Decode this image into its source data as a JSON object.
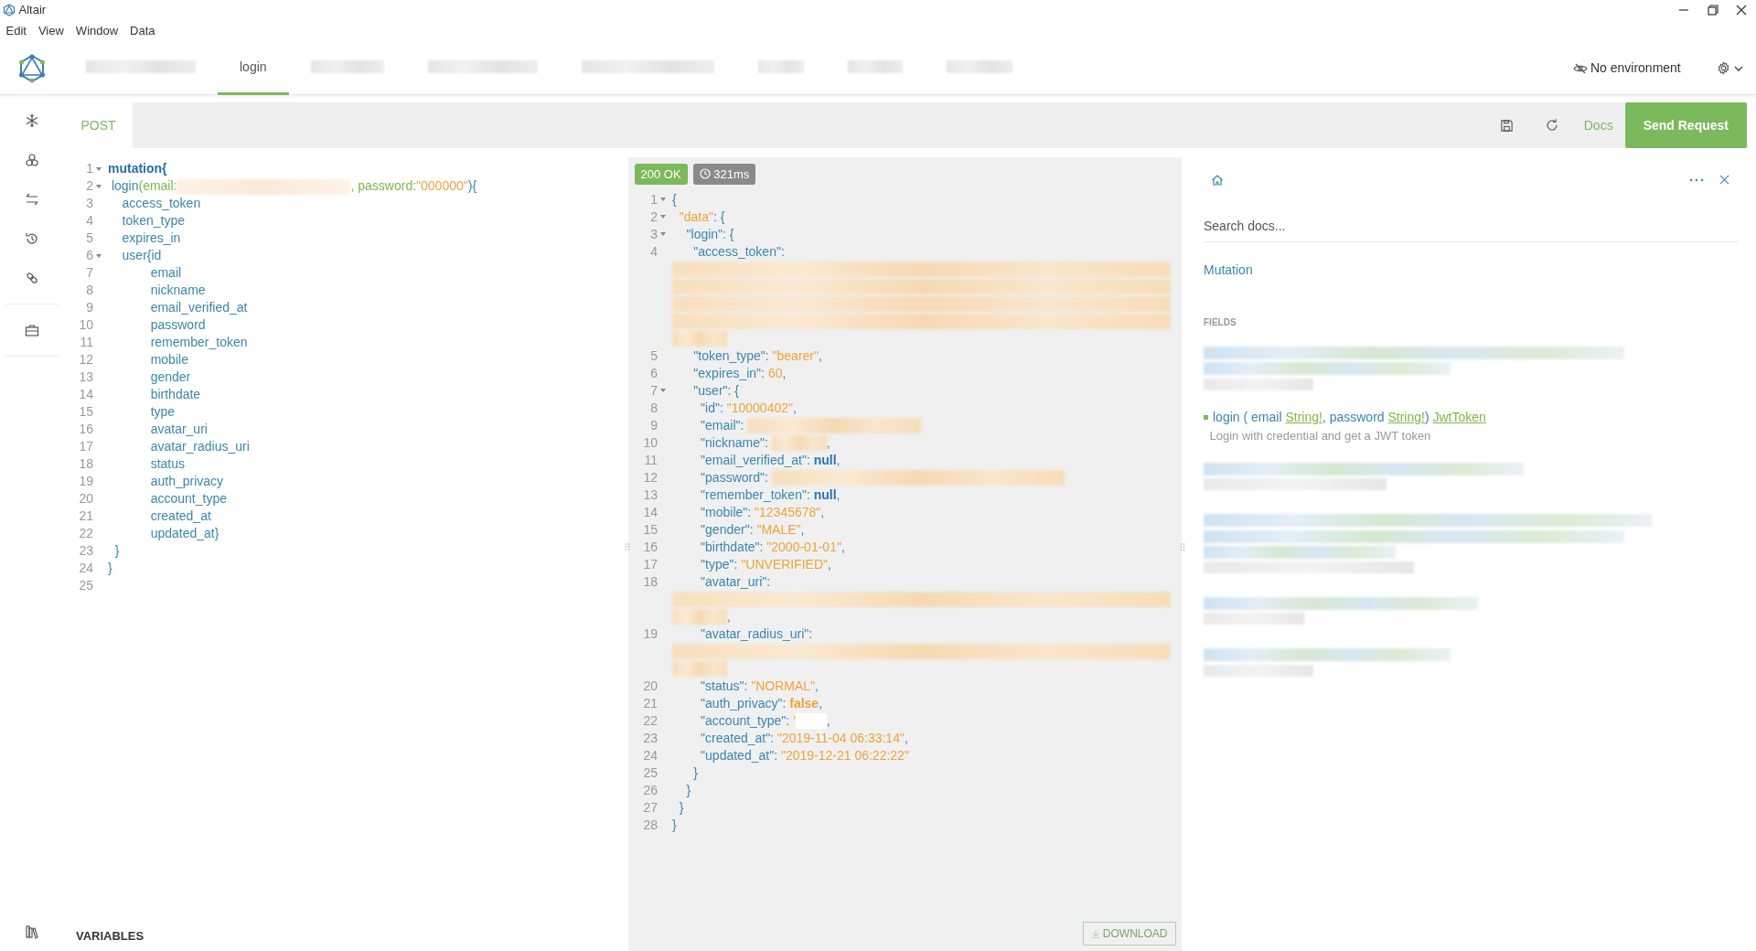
{
  "window": {
    "title": "Altair"
  },
  "menu": [
    "Edit",
    "View",
    "Window",
    "Data"
  ],
  "tabs": [
    {
      "kind": "redacted",
      "selected": false
    },
    {
      "kind": "label",
      "label": "login",
      "selected": true
    },
    {
      "kind": "redacted",
      "selected": false
    },
    {
      "kind": "redacted",
      "selected": false
    },
    {
      "kind": "redacted",
      "selected": false
    },
    {
      "kind": "redacted",
      "selected": false
    },
    {
      "kind": "redacted",
      "selected": false
    },
    {
      "kind": "redacted",
      "selected": false
    }
  ],
  "environment": "No environment",
  "request": {
    "method": "POST",
    "docs": "Docs",
    "send": "Send Request"
  },
  "query": {
    "lines": [
      {
        "number": "1",
        "fold": true,
        "tokens": [
          {
            "kind": "keyword",
            "text": "mutation{"
          }
        ]
      },
      {
        "number": "2",
        "fold": true,
        "tokens": [
          {
            "kind": "field",
            "text": " login"
          },
          {
            "kind": "arg",
            "text": "(email:"
          },
          {
            "kind": "redacted"
          },
          {
            "kind": "arg",
            "text": ", password:"
          },
          {
            "kind": "string",
            "text": "\"000000\""
          },
          {
            "kind": "field",
            "text": "){"
          }
        ]
      },
      {
        "number": "3",
        "fold": false,
        "tokens": [
          {
            "kind": "field",
            "text": "    access_token"
          }
        ]
      },
      {
        "number": "4",
        "fold": false,
        "tokens": [
          {
            "kind": "field",
            "text": "    token_type"
          }
        ]
      },
      {
        "number": "5",
        "fold": false,
        "tokens": [
          {
            "kind": "field",
            "text": "    expires_in"
          }
        ]
      },
      {
        "number": "6",
        "fold": true,
        "tokens": [
          {
            "kind": "field",
            "text": "    user{id"
          }
        ]
      },
      {
        "number": "7",
        "fold": false,
        "tokens": [
          {
            "kind": "field",
            "text": "            email"
          }
        ]
      },
      {
        "number": "8",
        "fold": false,
        "tokens": [
          {
            "kind": "field",
            "text": "            nickname"
          }
        ]
      },
      {
        "number": "9",
        "fold": false,
        "tokens": [
          {
            "kind": "field",
            "text": "            email_verified_at"
          }
        ]
      },
      {
        "number": "10",
        "fold": false,
        "tokens": [
          {
            "kind": "field",
            "text": "            password"
          }
        ]
      },
      {
        "number": "11",
        "fold": false,
        "tokens": [
          {
            "kind": "field",
            "text": "            remember_token"
          }
        ]
      },
      {
        "number": "12",
        "fold": false,
        "tokens": [
          {
            "kind": "field",
            "text": "            mobile"
          }
        ]
      },
      {
        "number": "13",
        "fold": false,
        "tokens": [
          {
            "kind": "field",
            "text": "            gender"
          }
        ]
      },
      {
        "number": "14",
        "fold": false,
        "tokens": [
          {
            "kind": "field",
            "text": "            birthdate"
          }
        ]
      },
      {
        "number": "15",
        "fold": false,
        "tokens": [
          {
            "kind": "field",
            "text": "            type"
          }
        ]
      },
      {
        "number": "16",
        "fold": false,
        "tokens": [
          {
            "kind": "field",
            "text": "            avatar_uri"
          }
        ]
      },
      {
        "number": "17",
        "fold": false,
        "tokens": [
          {
            "kind": "field",
            "text": "            avatar_radius_uri"
          }
        ]
      },
      {
        "number": "18",
        "fold": false,
        "tokens": [
          {
            "kind": "field",
            "text": "            status"
          }
        ]
      },
      {
        "number": "19",
        "fold": false,
        "tokens": [
          {
            "kind": "field",
            "text": "            auth_privacy"
          }
        ]
      },
      {
        "number": "20",
        "fold": false,
        "tokens": [
          {
            "kind": "field",
            "text": "            account_type"
          }
        ]
      },
      {
        "number": "21",
        "fold": false,
        "tokens": [
          {
            "kind": "field",
            "text": "            created_at"
          }
        ]
      },
      {
        "number": "22",
        "fold": false,
        "tokens": [
          {
            "kind": "field",
            "text": "            updated_at}"
          }
        ]
      },
      {
        "number": "23",
        "fold": false,
        "tokens": [
          {
            "kind": "field",
            "text": "  }"
          }
        ]
      },
      {
        "number": "24",
        "fold": false,
        "tokens": [
          {
            "kind": "field",
            "text": "}"
          }
        ]
      },
      {
        "number": "25",
        "fold": false
      }
    ]
  },
  "variables_label": "VARIABLES",
  "response": {
    "status": "200 OK",
    "time": "321ms",
    "download": "DOWNLOAD",
    "lines": [
      {
        "number": "1",
        "fold": true,
        "tokens": [
          {
            "kind": "punct",
            "text": "{"
          }
        ]
      },
      {
        "number": "2",
        "fold": true,
        "tokens": [
          {
            "kind": "string",
            "text": "  \"data\""
          },
          {
            "kind": "punct",
            "text": ": {"
          }
        ]
      },
      {
        "number": "3",
        "fold": true,
        "tokens": [
          {
            "kind": "punct",
            "text": "    \"login\": {"
          }
        ]
      },
      {
        "number": "4",
        "fold": false,
        "tokens": [
          {
            "kind": "punct",
            "text": "      \"access_token\":"
          }
        ]
      },
      {
        "tokens": [
          {
            "kind": "redacted"
          }
        ]
      },
      {
        "tokens": [
          {
            "kind": "redacted"
          }
        ]
      },
      {
        "tokens": [
          {
            "kind": "redacted"
          }
        ]
      },
      {
        "tokens": [
          {
            "kind": "redacted"
          }
        ]
      },
      {
        "tokens": [
          {
            "kind": "redacted"
          }
        ]
      },
      {
        "number": "5",
        "fold": false,
        "tokens": [
          {
            "kind": "punct",
            "text": "      \"token_type\": "
          },
          {
            "kind": "string",
            "text": "\"bearer\""
          },
          {
            "kind": "punct",
            "text": ","
          }
        ]
      },
      {
        "number": "6",
        "fold": false,
        "tokens": [
          {
            "kind": "punct",
            "text": "      \"expires_in\": "
          },
          {
            "kind": "string",
            "text": "60"
          },
          {
            "kind": "punct",
            "text": ","
          }
        ]
      },
      {
        "number": "7",
        "fold": true,
        "tokens": [
          {
            "kind": "punct",
            "text": "      \"user\": {"
          }
        ]
      },
      {
        "number": "8",
        "fold": false,
        "tokens": [
          {
            "kind": "punct",
            "text": "        \"id\": "
          },
          {
            "kind": "string",
            "text": "\"10000402\""
          },
          {
            "kind": "punct",
            "text": ","
          }
        ]
      },
      {
        "number": "9",
        "fold": false,
        "tokens": [
          {
            "kind": "punct",
            "text": "        \"email\": "
          },
          {
            "kind": "redacted"
          }
        ]
      },
      {
        "number": "10",
        "fold": false,
        "tokens": [
          {
            "kind": "punct",
            "text": "        \"nickname\": "
          },
          {
            "kind": "redacted"
          },
          {
            "kind": "punct",
            "text": ","
          }
        ]
      },
      {
        "number": "11",
        "fold": false,
        "tokens": [
          {
            "kind": "punct",
            "text": "        \"email_verified_at\": "
          },
          {
            "kind": "null",
            "text": "null"
          },
          {
            "kind": "punct",
            "text": ","
          }
        ]
      },
      {
        "number": "12",
        "fold": false,
        "tokens": [
          {
            "kind": "punct",
            "text": "        \"password\": "
          },
          {
            "kind": "redacted"
          }
        ]
      },
      {
        "number": "13",
        "fold": false,
        "tokens": [
          {
            "kind": "punct",
            "text": "        \"remember_token\": "
          },
          {
            "kind": "null",
            "text": "null"
          },
          {
            "kind": "punct",
            "text": ","
          }
        ]
      },
      {
        "number": "14",
        "fold": false,
        "tokens": [
          {
            "kind": "punct",
            "text": "        \"mobile\": "
          },
          {
            "kind": "string",
            "text": "\"12345678\""
          },
          {
            "kind": "punct",
            "text": ","
          }
        ]
      },
      {
        "number": "15",
        "fold": false,
        "tokens": [
          {
            "kind": "punct",
            "text": "        \"gender\": "
          },
          {
            "kind": "string",
            "text": "\"MALE\""
          },
          {
            "kind": "punct",
            "text": ","
          }
        ]
      },
      {
        "number": "16",
        "fold": false,
        "tokens": [
          {
            "kind": "punct",
            "text": "        \"birthdate\": "
          },
          {
            "kind": "string",
            "text": "\"2000-01-01\""
          },
          {
            "kind": "punct",
            "text": ","
          }
        ]
      },
      {
        "number": "17",
        "fold": false,
        "tokens": [
          {
            "kind": "punct",
            "text": "        \"type\": "
          },
          {
            "kind": "string",
            "text": "\"UNVERIFIED\""
          },
          {
            "kind": "punct",
            "text": ","
          }
        ]
      },
      {
        "number": "18",
        "fold": false,
        "tokens": [
          {
            "kind": "punct",
            "text": "        \"avatar_uri\":"
          }
        ]
      },
      {
        "tokens": [
          {
            "kind": "redacted"
          }
        ]
      },
      {
        "tokens": [
          {
            "kind": "redacted"
          },
          {
            "kind": "punct",
            "text": ","
          }
        ]
      },
      {
        "number": "19",
        "fold": false,
        "tokens": [
          {
            "kind": "punct",
            "text": "        \"avatar_radius_uri\":"
          }
        ]
      },
      {
        "tokens": [
          {
            "kind": "redacted"
          }
        ]
      },
      {
        "tokens": [
          {
            "kind": "redacted"
          }
        ]
      },
      {
        "number": "20",
        "fold": false,
        "tokens": [
          {
            "kind": "punct",
            "text": "        \"status\": "
          },
          {
            "kind": "string",
            "text": "\"NORMAL\""
          },
          {
            "kind": "punct",
            "text": ","
          }
        ]
      },
      {
        "number": "21",
        "fold": false,
        "tokens": [
          {
            "kind": "punct",
            "text": "        \"auth_privacy\": "
          },
          {
            "kind": "bool",
            "text": "false"
          },
          {
            "kind": "punct",
            "text": ","
          }
        ]
      },
      {
        "number": "22",
        "fold": false,
        "tokens": [
          {
            "kind": "punct",
            "text": "        \"account_type\": "
          },
          {
            "kind": "string",
            "text": "'"
          },
          {
            "kind": "blank"
          },
          {
            "kind": "punct",
            "text": ","
          }
        ]
      },
      {
        "number": "23",
        "fold": false,
        "tokens": [
          {
            "kind": "punct",
            "text": "        \"created_at\": "
          },
          {
            "kind": "string",
            "text": "\"2019-11-04 06:33:14\""
          },
          {
            "kind": "punct",
            "text": ","
          }
        ]
      },
      {
        "number": "24",
        "fold": false,
        "tokens": [
          {
            "kind": "punct",
            "text": "        \"updated_at\": "
          },
          {
            "kind": "string",
            "text": "\"2019-12-21 06:22:22\""
          }
        ]
      },
      {
        "number": "25",
        "fold": false,
        "tokens": [
          {
            "kind": "punct",
            "text": "      }"
          }
        ]
      },
      {
        "number": "26",
        "fold": false,
        "tokens": [
          {
            "kind": "punct",
            "text": "    }"
          }
        ]
      },
      {
        "number": "27",
        "fold": false,
        "tokens": [
          {
            "kind": "punct",
            "text": "  }"
          }
        ]
      },
      {
        "number": "28",
        "fold": false,
        "tokens": [
          {
            "kind": "punct",
            "text": "}"
          }
        ]
      }
    ]
  },
  "docs": {
    "search": {
      "placeholder": "Search docs..."
    },
    "type_name": "Mutation",
    "section": "FIELDS",
    "fields": [
      {
        "kind": "redacted"
      },
      {
        "kind": "field",
        "tokens": [
          {
            "kind": "name",
            "text": "login"
          },
          {
            "kind": "punct",
            "text": "("
          },
          {
            "kind": "arg",
            "text": "email"
          },
          {
            "kind": "type",
            "text": "String!"
          },
          {
            "kind": "punct",
            "text": ","
          },
          {
            "kind": "arg",
            "text": "password"
          },
          {
            "kind": "type",
            "text": "String!"
          },
          {
            "kind": "punct",
            "text": ")"
          },
          {
            "kind": "type",
            "text": "JwtToken"
          }
        ],
        "description": "Login with credential and get a JWT token"
      },
      {
        "kind": "redacted"
      },
      {
        "kind": "redacted"
      },
      {
        "kind": "redacted"
      },
      {
        "kind": "redacted"
      }
    ]
  }
}
